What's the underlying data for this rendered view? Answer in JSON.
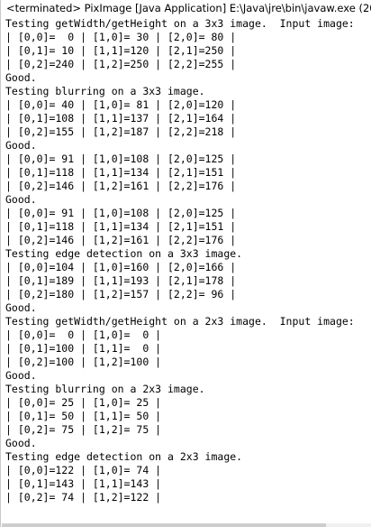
{
  "console": {
    "title": "<terminated> PixImage [Java Application] E:\\Java\\jre\\bin\\javaw.exe (20",
    "lines": [
      "Testing getWidth/getHeight on a 3x3 image.  Input image:",
      "| [0,0]=  0 | [1,0]= 30 | [2,0]= 80 |",
      "| [0,1]= 10 | [1,1]=120 | [2,1]=250 |",
      "| [0,2]=240 | [1,2]=250 | [2,2]=255 |",
      "Good.",
      "Testing blurring on a 3x3 image.",
      "| [0,0]= 40 | [1,0]= 81 | [2,0]=120 |",
      "| [0,1]=108 | [1,1]=137 | [2,1]=164 |",
      "| [0,2]=155 | [1,2]=187 | [2,2]=218 |",
      "Good.",
      "| [0,0]= 91 | [1,0]=108 | [2,0]=125 |",
      "| [0,1]=118 | [1,1]=134 | [2,1]=151 |",
      "| [0,2]=146 | [1,2]=161 | [2,2]=176 |",
      "Good.",
      "| [0,0]= 91 | [1,0]=108 | [2,0]=125 |",
      "| [0,1]=118 | [1,1]=134 | [2,1]=151 |",
      "| [0,2]=146 | [1,2]=161 | [2,2]=176 |",
      "Testing edge detection on a 3x3 image.",
      "| [0,0]=104 | [1,0]=160 | [2,0]=166 |",
      "| [0,1]=189 | [1,1]=193 | [2,1]=178 |",
      "| [0,2]=180 | [1,2]=157 | [2,2]= 96 |",
      "Good.",
      "Testing getWidth/getHeight on a 2x3 image.  Input image:",
      "| [0,0]=  0 | [1,0]=  0 |",
      "| [0,1]=100 | [1,1]=  0 |",
      "| [0,2]=100 | [1,2]=100 |",
      "Good.",
      "Testing blurring on a 2x3 image.",
      "| [0,0]= 25 | [1,0]= 25 |",
      "| [0,1]= 50 | [1,1]= 50 |",
      "| [0,2]= 75 | [1,2]= 75 |",
      "Good.",
      "Testing edge detection on a 2x3 image.",
      "| [0,0]=122 | [1,0]= 74 |",
      "| [0,1]=143 | [1,1]=143 |",
      "| [0,2]= 74 | [1,2]=122 |"
    ]
  }
}
